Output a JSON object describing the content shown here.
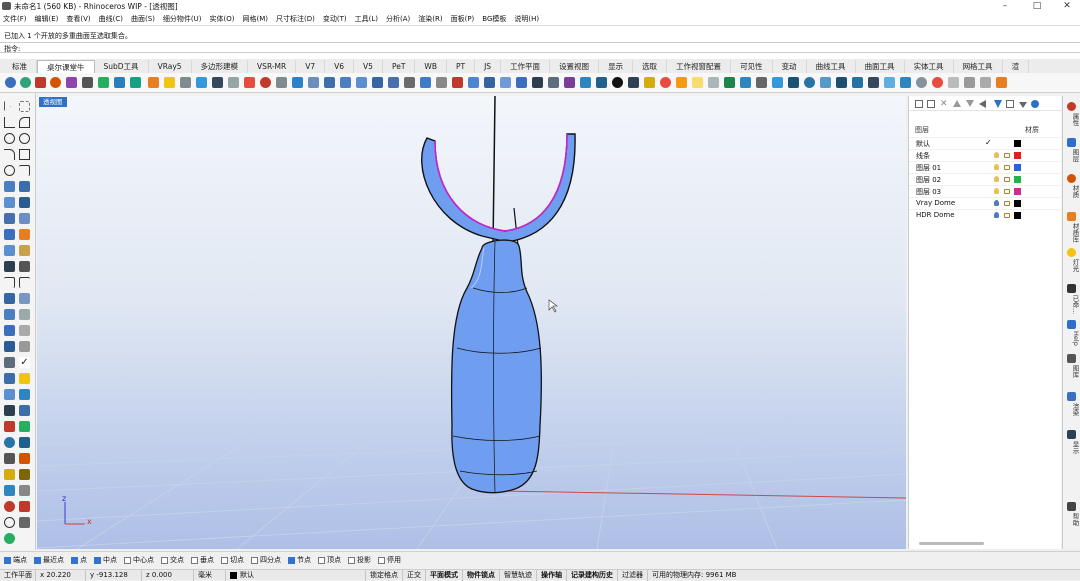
{
  "window": {
    "title": "未命名1 (560 KB) - Rhinoceros WIP - [透视图]",
    "minimize": "–",
    "maximize": "□",
    "close": "✕"
  },
  "menu": [
    "文件(F)",
    "编辑(E)",
    "查看(V)",
    "曲线(C)",
    "曲面(S)",
    "细分物件(U)",
    "实体(O)",
    "网格(M)",
    "尺寸标注(D)",
    "变动(T)",
    "工具(L)",
    "分析(A)",
    "渲染(R)",
    "面板(P)",
    "BG模板",
    "说明(H)"
  ],
  "command": {
    "history": "已加入 1 个开放的多重曲面至选取集合。",
    "prompt_label": "指令:",
    "value": ""
  },
  "tabs": [
    {
      "label": "标准",
      "active": false
    },
    {
      "label": "桌尔课堂牛",
      "active": true
    },
    {
      "label": "SubD工具",
      "active": false
    },
    {
      "label": "VRay5",
      "active": false
    },
    {
      "label": "多边形建模",
      "active": false
    },
    {
      "label": "VSR-MR",
      "active": false
    },
    {
      "label": "V7",
      "active": false
    },
    {
      "label": "V6",
      "active": false
    },
    {
      "label": "V5",
      "active": false
    },
    {
      "label": "PeT",
      "active": false
    },
    {
      "label": "WB",
      "active": false
    },
    {
      "label": "PT",
      "active": false
    },
    {
      "label": "JS",
      "active": false
    },
    {
      "label": "工作平面",
      "active": false
    },
    {
      "label": "设置视图",
      "active": false
    },
    {
      "label": "显示",
      "active": false
    },
    {
      "label": "选取",
      "active": false
    },
    {
      "label": "工作视窗配置",
      "active": false
    },
    {
      "label": "可见性",
      "active": false
    },
    {
      "label": "变动",
      "active": false
    },
    {
      "label": "曲线工具",
      "active": false
    },
    {
      "label": "曲面工具",
      "active": false
    },
    {
      "label": "实体工具",
      "active": false
    },
    {
      "label": "网格工具",
      "active": false
    },
    {
      "label": "渲",
      "active": false
    }
  ],
  "viewport": {
    "label": "透视图",
    "axis_z": "z",
    "axis_x": "x"
  },
  "layers_panel": {
    "col_layer": "图层",
    "col_material": "材质",
    "rows": [
      {
        "name": "默认",
        "current": true,
        "check": "✓",
        "color": "#000000"
      },
      {
        "name": "线条",
        "current": false,
        "check": "",
        "color": "#e02020"
      },
      {
        "name": "图层 01",
        "current": false,
        "check": "",
        "color": "#2a62d9"
      },
      {
        "name": "图层 02",
        "current": false,
        "check": "",
        "color": "#22b34a"
      },
      {
        "name": "图层 03",
        "current": false,
        "check": "",
        "color": "#d42a8a"
      },
      {
        "name": "Vray Dome",
        "current": false,
        "check": "",
        "color": "#000000"
      },
      {
        "name": "HDR Dome",
        "current": false,
        "check": "",
        "color": "#000000"
      }
    ]
  },
  "right_tabs": [
    "属性",
    "图层",
    "材质",
    "材质库",
    "灯光",
    "已命…",
    "Help",
    "图库",
    "渲染",
    "显示",
    "帮助"
  ],
  "osnaps": [
    {
      "label": "端点",
      "on": true
    },
    {
      "label": "最近点",
      "on": true
    },
    {
      "label": "点",
      "on": true
    },
    {
      "label": "中点",
      "on": true
    },
    {
      "label": "中心点",
      "on": false
    },
    {
      "label": "交点",
      "on": false
    },
    {
      "label": "垂点",
      "on": false
    },
    {
      "label": "切点",
      "on": false
    },
    {
      "label": "四分点",
      "on": false
    },
    {
      "label": "节点",
      "on": true
    },
    {
      "label": "顶点",
      "on": false
    },
    {
      "label": "投影",
      "on": false
    },
    {
      "label": "停用",
      "on": false
    }
  ],
  "status": {
    "cplane": "工作平面",
    "x": "x 20.220",
    "y": "y -913.128",
    "z": "z 0.000",
    "units": "毫米",
    "layer": "默认",
    "lock_grid": "锁定格点",
    "ortho": "正交",
    "planar": "平面模式",
    "osnap": "物件锁点",
    "smarttrack": "智慧轨迹",
    "gumball": "操作轴",
    "history": "记录建构历史",
    "filter": "过滤器",
    "memory": "可用的物理内存: 9961 MB"
  },
  "colors": {
    "accent": "#2f6fc9",
    "model": "#6f9df0",
    "highlight": "#d21fd2"
  }
}
